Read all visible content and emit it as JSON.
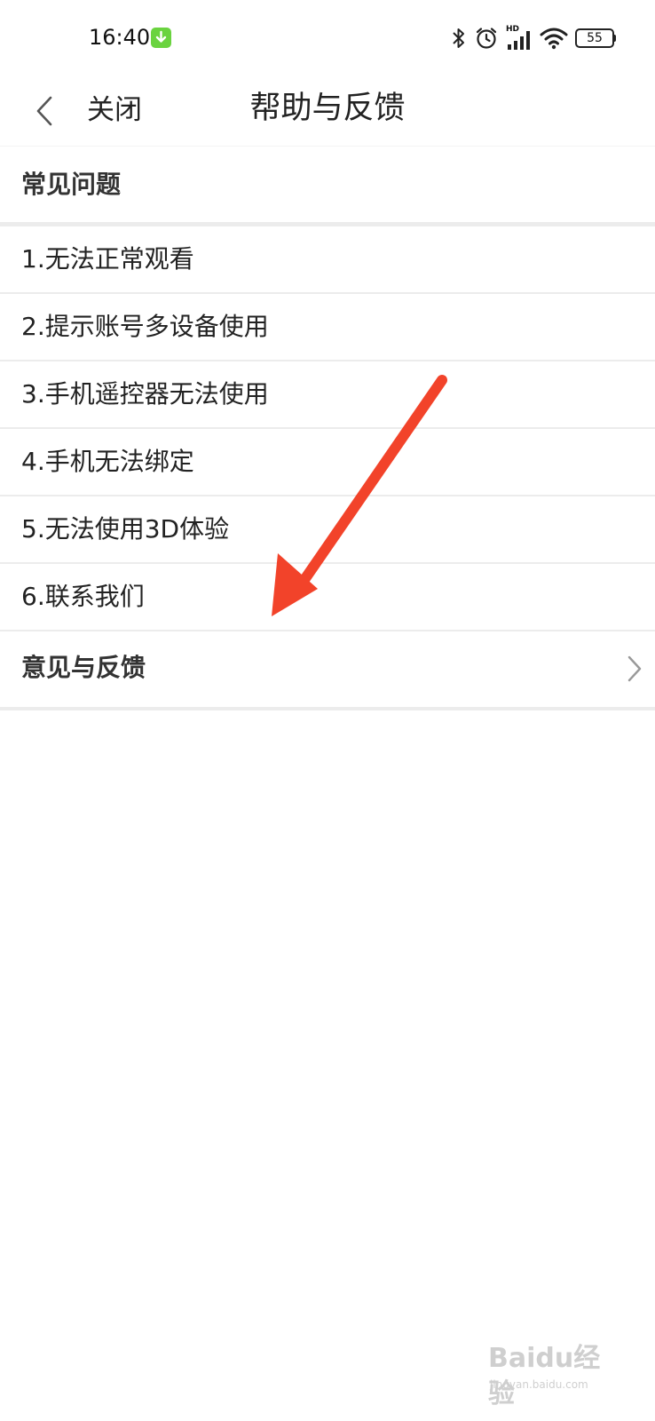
{
  "status_bar": {
    "time": "16:40",
    "battery_level": "55",
    "icons": [
      "bluetooth-icon",
      "alarm-icon",
      "hd-signal-icon",
      "wifi-icon",
      "battery-icon",
      "download-notification-icon"
    ],
    "hd_label": "HD",
    "notification_color": "#6ad33f"
  },
  "nav": {
    "back_icon": "chevron-left-icon",
    "close_label": "关闭",
    "title": "帮助与反馈"
  },
  "faq": {
    "section_title": "常见问题",
    "items": [
      {
        "label": "1.无法正常观看"
      },
      {
        "label": "2.提示账号多设备使用"
      },
      {
        "label": "3.手机遥控器无法使用"
      },
      {
        "label": "4.手机无法绑定"
      },
      {
        "label": "5.无法使用3D体验"
      },
      {
        "label": "6.联系我们"
      }
    ]
  },
  "feedback": {
    "label": "意见与反馈",
    "icon": "chevron-right-icon"
  },
  "annotation": {
    "arrow_color": "#f2432a"
  },
  "watermark": {
    "logo": "Baidu经验",
    "url": "jingyan.baidu.com"
  }
}
